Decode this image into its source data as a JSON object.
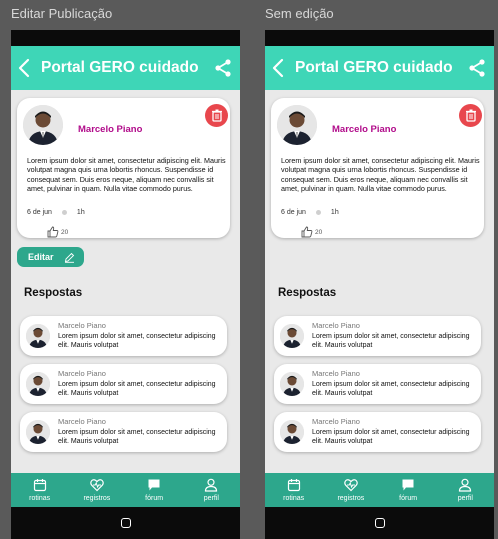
{
  "labels": {
    "left": "Editar Publicação",
    "right": "Sem edição"
  },
  "header": {
    "title": "Portal GERO cuidado"
  },
  "post": {
    "author": "Marcelo Piano",
    "body": "Lorem ipsum dolor sit amet, consectetur adipiscing elit. Mauris volutpat magna quis urna lobortis rhoncus. Suspendisse id consequat sem. Duis eros neque, aliquam nec convallis sit amet, pulvinar in quam. Nulla vitae commodo purus.",
    "date": "6 de jun",
    "time": "1h",
    "likes": "20"
  },
  "edit_label": "Editar",
  "answers_title": "Respostas",
  "replies": [
    {
      "name": "Marcelo Piano",
      "text": "Lorem ipsum dolor sit amet, consectetur adipiscing elit. Mauris volutpat"
    },
    {
      "name": "Marcelo Piano",
      "text": "Lorem ipsum dolor sit amet, consectetur adipiscing elit. Mauris volutpat"
    },
    {
      "name": "Marcelo Piano",
      "text": "Lorem ipsum dolor sit amet, consectetur adipiscing elit. Mauris volutpat"
    }
  ],
  "nav": [
    {
      "label": "rotinas",
      "icon": "calendar-icon"
    },
    {
      "label": "registros",
      "icon": "heart-pulse-icon"
    },
    {
      "label": "fórum",
      "icon": "chat-icon"
    },
    {
      "label": "perfil",
      "icon": "user-icon"
    }
  ],
  "colors": {
    "header": "#3ed6b7",
    "nav": "#2da78c",
    "author": "#b10b8a",
    "delete": "#e8474d"
  }
}
